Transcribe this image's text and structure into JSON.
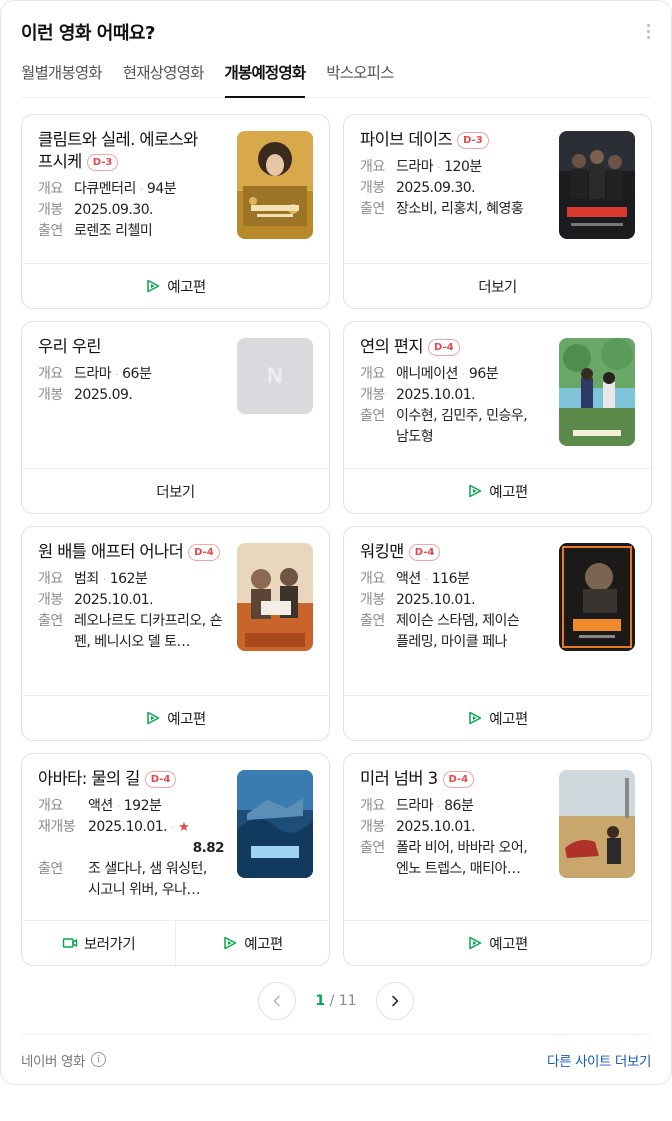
{
  "header": {
    "title": "이런 영화 어때요?"
  },
  "tabs": [
    "월별개봉영화",
    "현재상영영화",
    "개봉예정영화",
    "박스오피스"
  ],
  "labels": {
    "summary": "개요",
    "release": "개봉",
    "rerelease": "재개봉",
    "cast": "출연",
    "trailer": "예고편",
    "more": "더보기",
    "watch": "보러가기",
    "separator": "·",
    "star": "★",
    "placeholder": "N"
  },
  "movies": [
    {
      "title": "클림트와 실레. 에로스와 프시케",
      "badge": "D-3",
      "genre": "다큐멘터리",
      "runtime": "94분",
      "release": "2025.09.30.",
      "cast": "로렌조 리첼미"
    },
    {
      "title": "파이브 데이즈",
      "badge": "D-3",
      "genre": "드라마",
      "runtime": "120분",
      "release": "2025.09.30.",
      "cast": "장소비, 리홍치, 혜영홍"
    },
    {
      "title": "우리 우린",
      "genre": "드라마",
      "runtime": "66분",
      "release": "2025.09."
    },
    {
      "title": "연의 편지",
      "badge": "D-4",
      "genre": "애니메이션",
      "runtime": "96분",
      "release": "2025.10.01.",
      "cast": "이수현, 김민주, 민승우, 남도형"
    },
    {
      "title": "원 배틀 애프터 어나더",
      "badge": "D-4",
      "genre": "범죄",
      "runtime": "162분",
      "release": "2025.10.01.",
      "cast": "레오나르도 디카프리오, 숀 펜, 베니시오 델 토…"
    },
    {
      "title": "워킹맨",
      "badge": "D-4",
      "genre": "액션",
      "runtime": "116분",
      "release": "2025.10.01.",
      "cast": "제이슨 스타뎀, 제이슨 플레밍, 마이클 페나"
    },
    {
      "title": "아바타: 물의 길",
      "badge": "D-4",
      "genre": "액션",
      "runtime": "192분",
      "release": "2025.10.01.",
      "rating": "8.82",
      "cast": "조 샐다나, 샘 워싱턴, 시고니 위버, 우나…"
    },
    {
      "title": "미러 넘버 3",
      "badge": "D-4",
      "genre": "드라마",
      "runtime": "86분",
      "release": "2025.10.01.",
      "cast": "폴라 비어, 바바라 오어, 엔노 트렙스, 매티아…"
    }
  ],
  "pagination": {
    "current": "1",
    "separator": "/",
    "total": "11"
  },
  "footer": {
    "source": "네이버 영화",
    "info": "i",
    "link": "다른 사이트 더보기"
  },
  "colors": {
    "accent_green": "#03a94d",
    "badge_red": "#e5484d",
    "link_blue": "#1a56c9"
  }
}
